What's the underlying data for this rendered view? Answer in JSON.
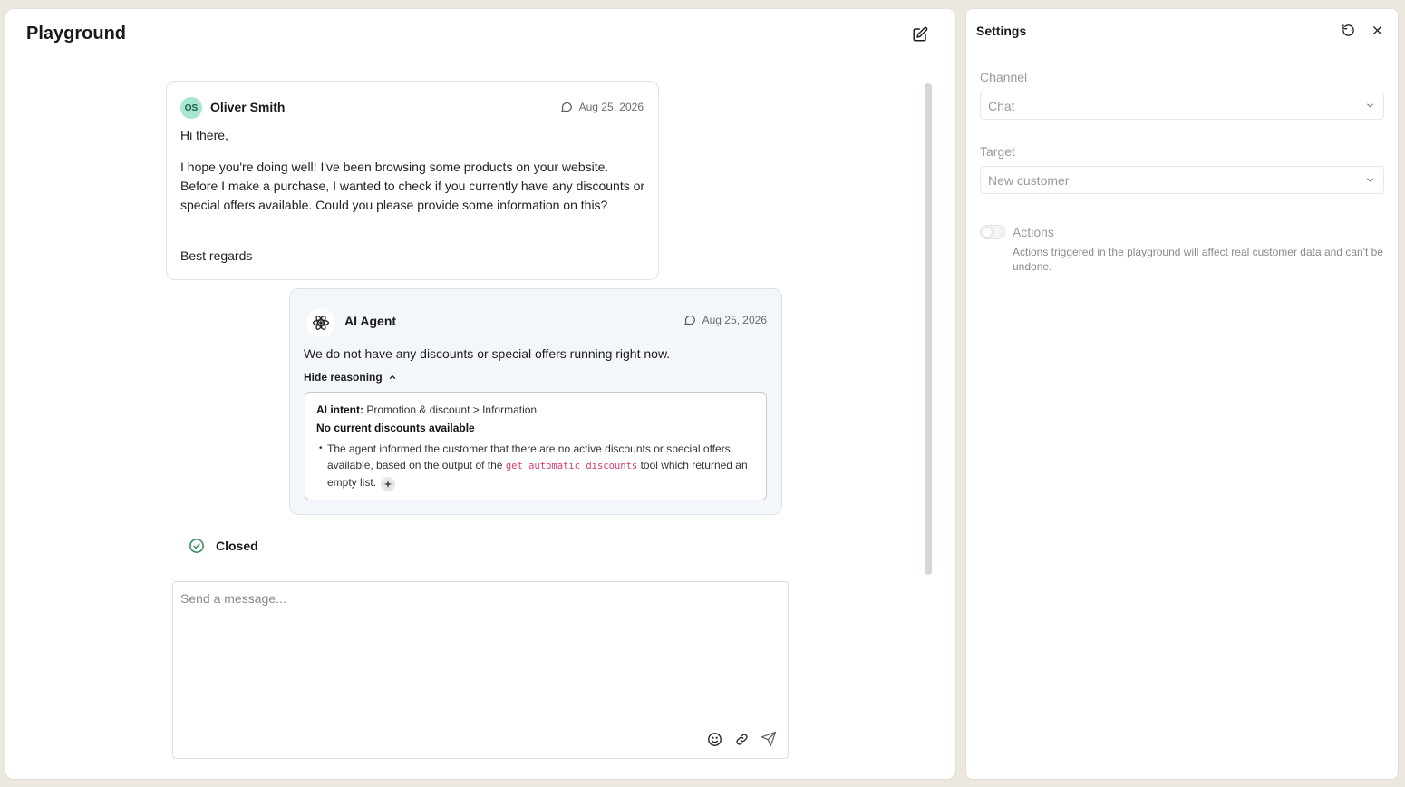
{
  "playground": {
    "title": "Playground",
    "customer_message": {
      "avatar_initials": "OS",
      "sender": "Oliver Smith",
      "date": "Aug 25, 2026",
      "greeting": "Hi there,",
      "body": "I hope you're doing well! I've been browsing some products on your website. Before I make a purchase, I wanted to check if you currently have any discounts or special offers available. Could you please provide some information on this?",
      "signoff": "Best regards"
    },
    "ai_message": {
      "sender": "AI Agent",
      "date": "Aug 25, 2026",
      "reply": "We do not have any discounts or special offers running right now.",
      "hide_reasoning_label": "Hide reasoning",
      "reasoning": {
        "intent_label": "AI intent:",
        "intent_value": "Promotion & discount > Information",
        "heading": "No current discounts available",
        "bullet_part1": "The agent informed the customer that there are no active discounts or special offers available, based on the output of the",
        "bullet_code": "get_automatic_discounts",
        "bullet_part2": "tool which returned an empty list."
      }
    },
    "status_label": "Closed",
    "composer": {
      "placeholder": "Send a message..."
    }
  },
  "settings": {
    "title": "Settings",
    "channel": {
      "label": "Channel",
      "value": "Chat"
    },
    "target": {
      "label": "Target",
      "value": "New customer"
    },
    "actions": {
      "label": "Actions",
      "enabled": false,
      "description": "Actions triggered in the playground will affect real customer data and can't be undone."
    }
  },
  "colors": {
    "page_bg": "#ece7df",
    "avatar_bg": "#a7e7cd",
    "ai_bubble_bg": "#f3f7fb",
    "status_green": "#2f8a5c",
    "code_pink": "#d63d6f"
  }
}
